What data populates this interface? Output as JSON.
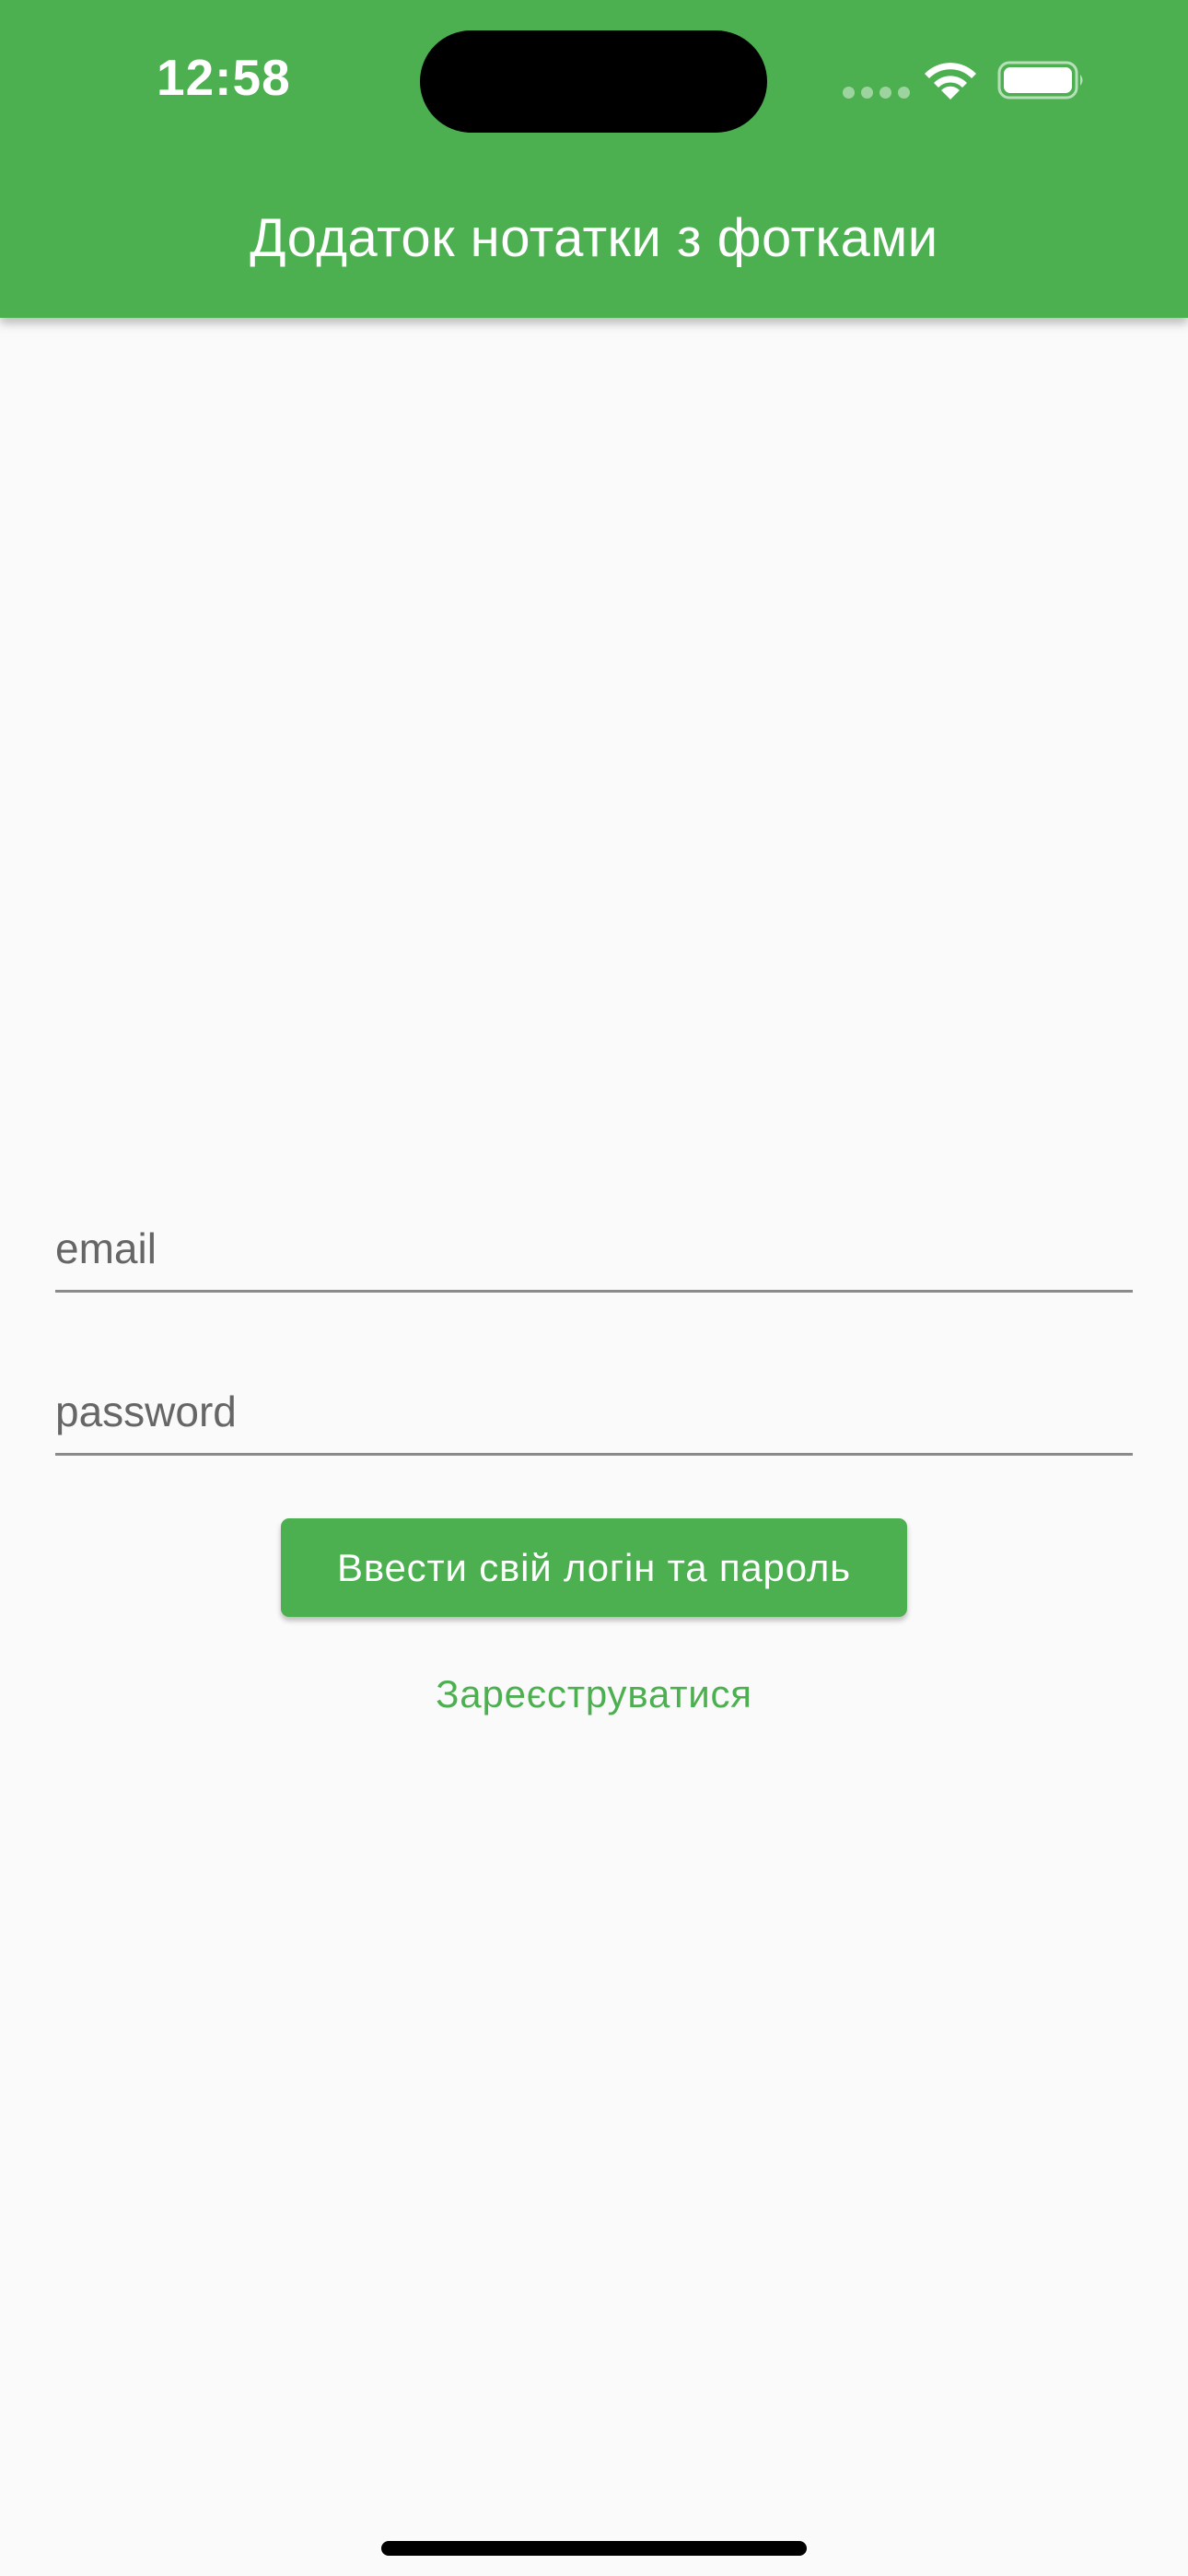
{
  "status_bar": {
    "time": "12:58"
  },
  "app_bar": {
    "title": "Додаток нотатки з фотками",
    "color": "#4caf50"
  },
  "form": {
    "email_placeholder": "email",
    "password_placeholder": "password",
    "login_button_label": "Ввести свій логін та пароль",
    "register_link_label": "Зареєструватися"
  },
  "icons": {
    "signal": "cellular-signal-icon",
    "wifi": "wifi-icon",
    "battery": "battery-icon"
  }
}
